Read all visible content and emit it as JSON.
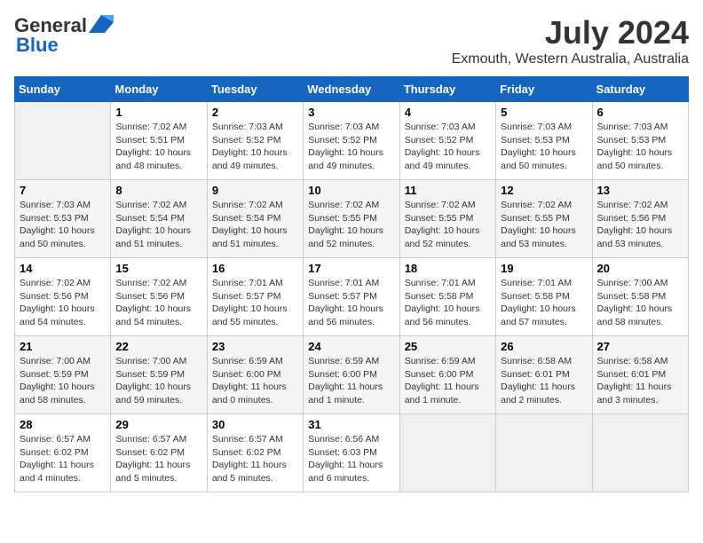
{
  "header": {
    "logo_general": "General",
    "logo_blue": "Blue",
    "title": "July 2024",
    "subtitle": "Exmouth, Western Australia, Australia"
  },
  "calendar": {
    "days_of_week": [
      "Sunday",
      "Monday",
      "Tuesday",
      "Wednesday",
      "Thursday",
      "Friday",
      "Saturday"
    ],
    "weeks": [
      [
        {
          "day": "",
          "info": ""
        },
        {
          "day": "1",
          "info": "Sunrise: 7:02 AM\nSunset: 5:51 PM\nDaylight: 10 hours\nand 48 minutes."
        },
        {
          "day": "2",
          "info": "Sunrise: 7:03 AM\nSunset: 5:52 PM\nDaylight: 10 hours\nand 49 minutes."
        },
        {
          "day": "3",
          "info": "Sunrise: 7:03 AM\nSunset: 5:52 PM\nDaylight: 10 hours\nand 49 minutes."
        },
        {
          "day": "4",
          "info": "Sunrise: 7:03 AM\nSunset: 5:52 PM\nDaylight: 10 hours\nand 49 minutes."
        },
        {
          "day": "5",
          "info": "Sunrise: 7:03 AM\nSunset: 5:53 PM\nDaylight: 10 hours\nand 50 minutes."
        },
        {
          "day": "6",
          "info": "Sunrise: 7:03 AM\nSunset: 5:53 PM\nDaylight: 10 hours\nand 50 minutes."
        }
      ],
      [
        {
          "day": "7",
          "info": "Sunrise: 7:03 AM\nSunset: 5:53 PM\nDaylight: 10 hours\nand 50 minutes."
        },
        {
          "day": "8",
          "info": "Sunrise: 7:02 AM\nSunset: 5:54 PM\nDaylight: 10 hours\nand 51 minutes."
        },
        {
          "day": "9",
          "info": "Sunrise: 7:02 AM\nSunset: 5:54 PM\nDaylight: 10 hours\nand 51 minutes."
        },
        {
          "day": "10",
          "info": "Sunrise: 7:02 AM\nSunset: 5:55 PM\nDaylight: 10 hours\nand 52 minutes."
        },
        {
          "day": "11",
          "info": "Sunrise: 7:02 AM\nSunset: 5:55 PM\nDaylight: 10 hours\nand 52 minutes."
        },
        {
          "day": "12",
          "info": "Sunrise: 7:02 AM\nSunset: 5:55 PM\nDaylight: 10 hours\nand 53 minutes."
        },
        {
          "day": "13",
          "info": "Sunrise: 7:02 AM\nSunset: 5:56 PM\nDaylight: 10 hours\nand 53 minutes."
        }
      ],
      [
        {
          "day": "14",
          "info": "Sunrise: 7:02 AM\nSunset: 5:56 PM\nDaylight: 10 hours\nand 54 minutes."
        },
        {
          "day": "15",
          "info": "Sunrise: 7:02 AM\nSunset: 5:56 PM\nDaylight: 10 hours\nand 54 minutes."
        },
        {
          "day": "16",
          "info": "Sunrise: 7:01 AM\nSunset: 5:57 PM\nDaylight: 10 hours\nand 55 minutes."
        },
        {
          "day": "17",
          "info": "Sunrise: 7:01 AM\nSunset: 5:57 PM\nDaylight: 10 hours\nand 56 minutes."
        },
        {
          "day": "18",
          "info": "Sunrise: 7:01 AM\nSunset: 5:58 PM\nDaylight: 10 hours\nand 56 minutes."
        },
        {
          "day": "19",
          "info": "Sunrise: 7:01 AM\nSunset: 5:58 PM\nDaylight: 10 hours\nand 57 minutes."
        },
        {
          "day": "20",
          "info": "Sunrise: 7:00 AM\nSunset: 5:58 PM\nDaylight: 10 hours\nand 58 minutes."
        }
      ],
      [
        {
          "day": "21",
          "info": "Sunrise: 7:00 AM\nSunset: 5:59 PM\nDaylight: 10 hours\nand 58 minutes."
        },
        {
          "day": "22",
          "info": "Sunrise: 7:00 AM\nSunset: 5:59 PM\nDaylight: 10 hours\nand 59 minutes."
        },
        {
          "day": "23",
          "info": "Sunrise: 6:59 AM\nSunset: 6:00 PM\nDaylight: 11 hours\nand 0 minutes."
        },
        {
          "day": "24",
          "info": "Sunrise: 6:59 AM\nSunset: 6:00 PM\nDaylight: 11 hours\nand 1 minute."
        },
        {
          "day": "25",
          "info": "Sunrise: 6:59 AM\nSunset: 6:00 PM\nDaylight: 11 hours\nand 1 minute."
        },
        {
          "day": "26",
          "info": "Sunrise: 6:58 AM\nSunset: 6:01 PM\nDaylight: 11 hours\nand 2 minutes."
        },
        {
          "day": "27",
          "info": "Sunrise: 6:58 AM\nSunset: 6:01 PM\nDaylight: 11 hours\nand 3 minutes."
        }
      ],
      [
        {
          "day": "28",
          "info": "Sunrise: 6:57 AM\nSunset: 6:02 PM\nDaylight: 11 hours\nand 4 minutes."
        },
        {
          "day": "29",
          "info": "Sunrise: 6:57 AM\nSunset: 6:02 PM\nDaylight: 11 hours\nand 5 minutes."
        },
        {
          "day": "30",
          "info": "Sunrise: 6:57 AM\nSunset: 6:02 PM\nDaylight: 11 hours\nand 5 minutes."
        },
        {
          "day": "31",
          "info": "Sunrise: 6:56 AM\nSunset: 6:03 PM\nDaylight: 11 hours\nand 6 minutes."
        },
        {
          "day": "",
          "info": ""
        },
        {
          "day": "",
          "info": ""
        },
        {
          "day": "",
          "info": ""
        }
      ]
    ]
  }
}
